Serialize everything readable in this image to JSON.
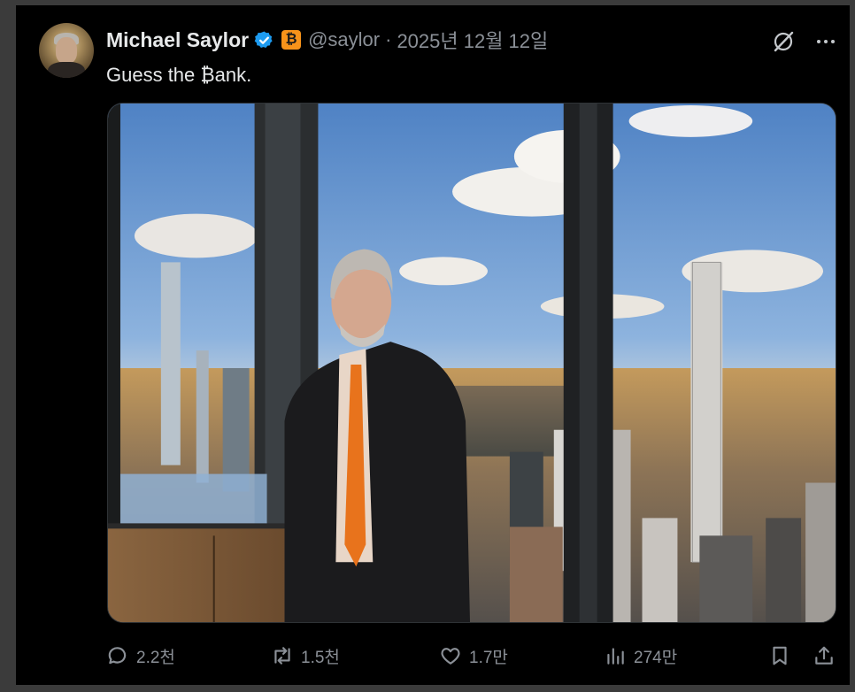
{
  "post": {
    "display_name": "Michael Saylor",
    "verified_icon": "verified-badge-icon",
    "affiliate_badge": "₿",
    "handle": "@saylor",
    "separator": "·",
    "date": "2025년 12월 12일",
    "text": "Guess the ₿ank."
  },
  "header_icons": [
    "grok-icon",
    "more-icon"
  ],
  "media": {
    "kind": "photo",
    "alt_hint": "man in suit with orange tie standing by windows overlooking New York city skyline"
  },
  "actions": {
    "replies": "2.2천",
    "reposts": "1.5천",
    "likes": "1.7만",
    "views": "274만"
  },
  "colors": {
    "background": "#000000",
    "text": "#e7e9ea",
    "muted": "#8b9097",
    "verified": "#1d9bf0",
    "bitcoin": "#f7931a",
    "tie": "#e8731c"
  }
}
